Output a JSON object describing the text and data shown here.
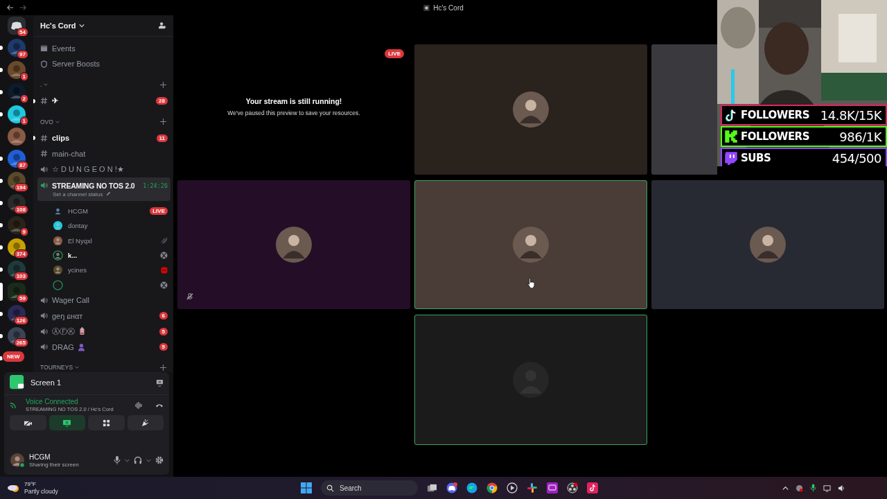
{
  "window": {
    "title": "Hc's Cord"
  },
  "servers": [
    {
      "kind": "home",
      "badge": "54",
      "unread": false,
      "selected": false
    },
    {
      "kind": "server",
      "badge": "97",
      "unread": true,
      "selected": false
    },
    {
      "kind": "server",
      "badge": "1",
      "unread": true,
      "selected": false
    },
    {
      "kind": "server",
      "badge": "2",
      "unread": true,
      "selected": false
    },
    {
      "kind": "server",
      "badge": "1",
      "unread": true,
      "selected": false
    },
    {
      "kind": "server",
      "unread": false,
      "selected": false
    },
    {
      "kind": "server",
      "badge": "87",
      "unread": true,
      "selected": false
    },
    {
      "kind": "server",
      "badge": "194",
      "unread": true,
      "selected": false
    },
    {
      "kind": "server",
      "badge": "108",
      "unread": true,
      "selected": false
    },
    {
      "kind": "server",
      "badge": "9",
      "unread": true,
      "selected": false
    },
    {
      "kind": "server",
      "badge": "374",
      "unread": true,
      "selected": false
    },
    {
      "kind": "server",
      "badge": "103",
      "unread": true,
      "selected": false
    },
    {
      "kind": "server",
      "badge": "59",
      "unread": false,
      "selected": true
    },
    {
      "kind": "server",
      "badge": "126",
      "unread": true,
      "selected": false
    },
    {
      "kind": "server",
      "badge": "265",
      "unread": true,
      "selected": false
    },
    {
      "kind": "new",
      "badge": "NEW",
      "unread": true,
      "selected": false
    }
  ],
  "sidebar": {
    "server_name": "Hc's Cord",
    "channels": [
      {
        "kind": "events",
        "label": "Events"
      },
      {
        "kind": "boosts",
        "label": "Server Boosts"
      },
      {
        "kind": "category",
        "label": "."
      },
      {
        "kind": "text",
        "label": "✈",
        "badge": "28",
        "unread": true,
        "selected": false
      },
      {
        "kind": "category",
        "label": "OVO"
      },
      {
        "kind": "text",
        "label": "clips",
        "badge": "11",
        "unread": true,
        "selected": false
      },
      {
        "kind": "text",
        "label": "main-chat",
        "unread": false,
        "selected": false
      },
      {
        "kind": "voice",
        "label": "☆ D U N G E O N !★",
        "selected": false
      },
      {
        "kind": "voice",
        "label": "STREAMING NO TOS 2.0",
        "selected": true,
        "timer": "1:24:26",
        "status": "Set a channel status",
        "children": [
          {
            "kind": "live",
            "name": "HCGM",
            "tag": "LIVE",
            "speaking": false
          },
          {
            "kind": "plain",
            "name": "dontay",
            "speaking": false
          },
          {
            "kind": "muted",
            "name": "El Nyqxl",
            "speaking": false
          },
          {
            "kind": "xbox",
            "name": "k...",
            "speaking": true
          },
          {
            "kind": "red",
            "name": "ycines",
            "speaking": false
          },
          {
            "kind": "xbox",
            "speaking": true
          }
        ]
      },
      {
        "kind": "voice",
        "label": "Wager Call",
        "selected": false
      },
      {
        "kind": "voice",
        "label": "ɡеŋ ɕнαт",
        "badge": "6",
        "selected": false
      },
      {
        "kind": "voice",
        "label": "ⒶⒻⓀ",
        "badge": "5",
        "selected": false
      },
      {
        "kind": "voice",
        "label": "DRAG",
        "badge": "5",
        "selected": false
      },
      {
        "kind": "category",
        "label": "TOURNEYS"
      }
    ]
  },
  "panel": {
    "screen_label": "Screen 1",
    "voice_status": "Voice Connected",
    "voice_channel": "STREAMING NO TOS 2.0 / Hc's Cord",
    "buttons": [
      {
        "on": false
      },
      {
        "on": true
      },
      {
        "on": false
      },
      {
        "on": false
      }
    ],
    "user": {
      "name": "HCGM",
      "status": "Sharing their screen"
    }
  },
  "tiles": [
    {
      "kind": "paused",
      "title": "Your stream is still running!",
      "message": "We've paused this preview to save your resources.",
      "tag": "LIVE",
      "speaking": false,
      "muted": false
    },
    {
      "kind": "avatar",
      "color": "#2a221d",
      "speaking": false,
      "muted": false
    },
    {
      "kind": "blank",
      "color": "#3a393d",
      "speaking": false,
      "muted": false
    },
    {
      "kind": "avatar",
      "color": "#230d27",
      "speaking": false,
      "muted": true
    },
    {
      "kind": "avatar",
      "color": "#4a3d37",
      "speaking": true,
      "muted": false
    },
    {
      "kind": "avatar",
      "color": "#272a33",
      "speaking": false,
      "muted": false
    },
    {
      "kind": "avatar",
      "color": "#1b1b1b",
      "speaking": true,
      "muted": false
    }
  ],
  "overlay": [
    {
      "label": "FOLLOWERS",
      "value": "14.8K/15K",
      "color": "#e0245e"
    },
    {
      "label": "FOLLOWERS",
      "value": "986/1K",
      "color": "#53fc18"
    },
    {
      "label": "SUBS",
      "value": "454/500",
      "color": "#9146ff"
    }
  ],
  "taskbar": {
    "weather_temp": "79°F",
    "weather_text": "Partly cloudy",
    "search_label": "Search"
  }
}
